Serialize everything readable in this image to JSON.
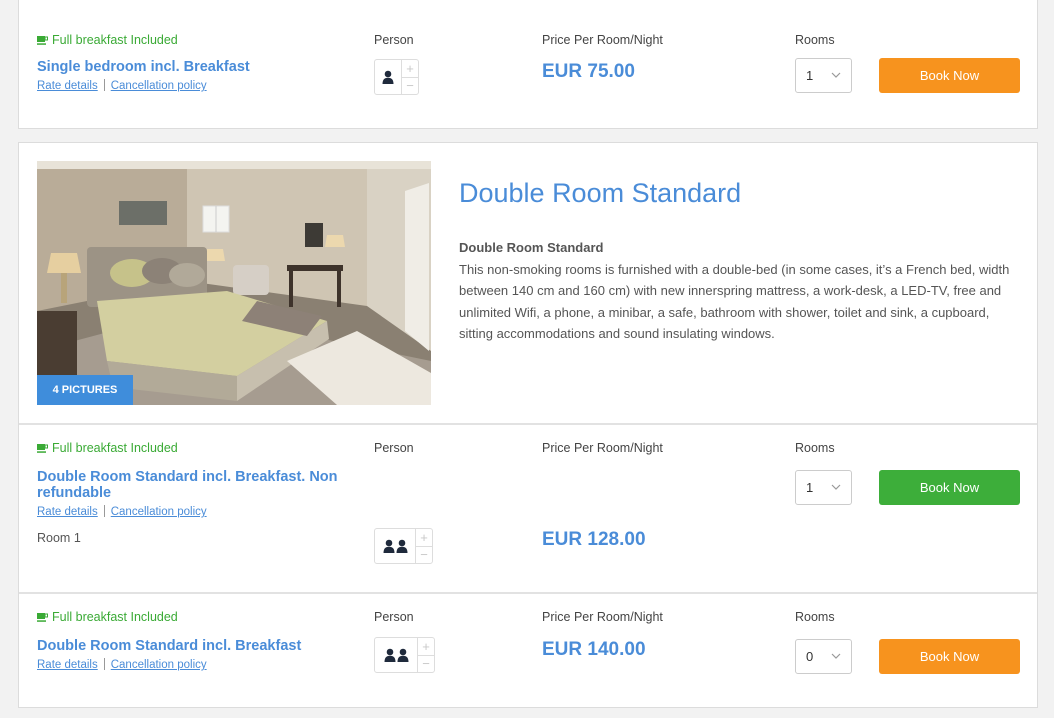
{
  "rates": [
    {
      "breakfast": "Full breakfast Included",
      "title": "Single bedroom incl. Breakfast",
      "rate_details": "Rate details",
      "cancellation": "Cancellation policy",
      "person_header": "Person",
      "price_header": "Price Per Room/Night",
      "price": "EUR 75.00",
      "rooms_header": "Rooms",
      "rooms_value": "1",
      "button": "Book Now",
      "button_color": "#f7931e",
      "persons": 1
    },
    {
      "breakfast": "Full breakfast Included",
      "title": "Double Room Standard incl. Breakfast. Non refundable",
      "rate_details": "Rate details",
      "cancellation": "Cancellation policy",
      "room_label": "Room 1",
      "person_header": "Person",
      "price_header": "Price Per Room/Night",
      "price": "EUR 128.00",
      "rooms_header": "Rooms",
      "rooms_value": "1",
      "button": "Book Now",
      "button_color": "#3dae3a",
      "persons": 2
    },
    {
      "breakfast": "Full breakfast Included",
      "title": "Double Room Standard incl. Breakfast",
      "rate_details": "Rate details",
      "cancellation": "Cancellation policy",
      "person_header": "Person",
      "price_header": "Price Per Room/Night",
      "price": "EUR 140.00",
      "rooms_header": "Rooms",
      "rooms_value": "0",
      "button": "Book Now",
      "button_color": "#f7931e",
      "persons": 2
    }
  ],
  "room": {
    "title": "Double Room Standard",
    "pictures_badge": "4 PICTURES",
    "desc_title": "Double Room Standard",
    "description": "This non-smoking rooms is furnished with a double-bed (in some cases, it’s a French bed, width between 140 cm and 160 cm) with new innerspring mattress, a work-desk, a LED-TV, free and unlimited Wifi, a phone, a minibar, a safe, bathroom with shower, toilet and sink, a cupboard, sitting accommodations and sound insulating windows."
  },
  "icons": {
    "breakfast": "coffee-cup-icon",
    "person": "person-icon",
    "plus": "plus-icon",
    "minus": "minus-icon",
    "chevron": "chevron-down-icon"
  },
  "colors": {
    "link": "#4a8cd8",
    "breakfast": "#3aaa35",
    "badge": "#3f8ddb"
  }
}
